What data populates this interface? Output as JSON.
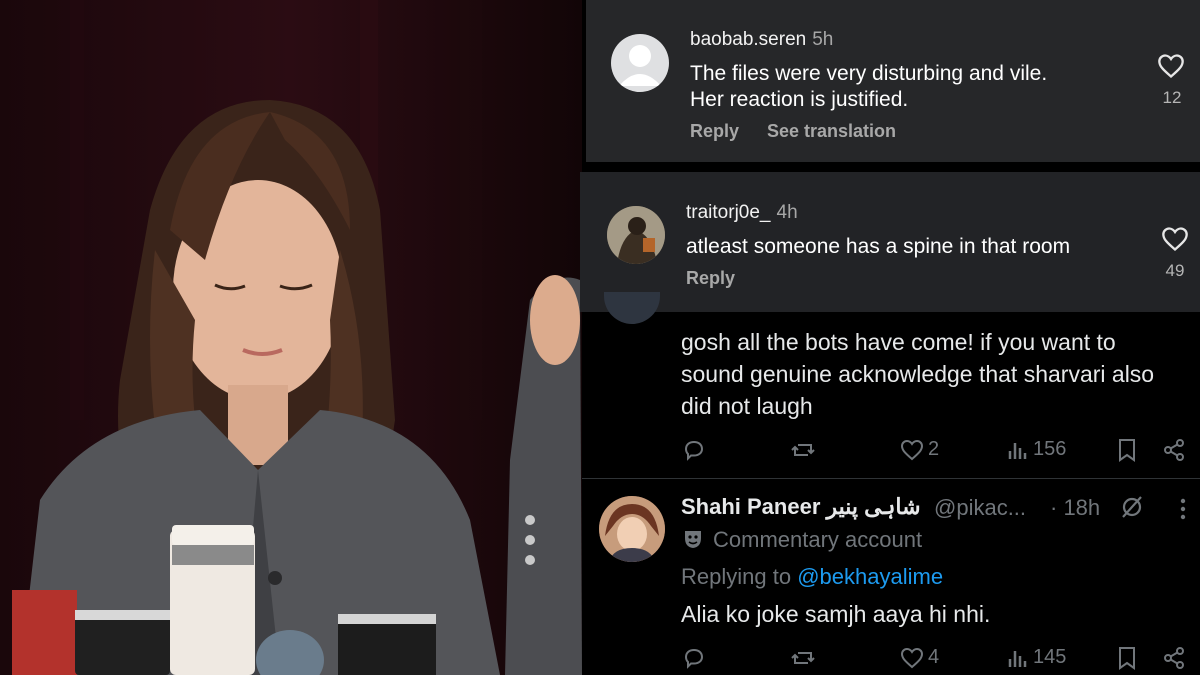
{
  "ig_comments": [
    {
      "username": "baobab.seren",
      "time": "5h",
      "text_line1": "The files were very disturbing and vile.",
      "text_line2": "Her reaction is justified.",
      "likes": "12",
      "reply_label": "Reply",
      "translate_label": "See translation"
    },
    {
      "username": "traitorj0e_",
      "time": "4h",
      "text_line1": "atleast someone has a spine in that room",
      "likes": "49",
      "reply_label": "Reply"
    }
  ],
  "tweets": [
    {
      "text_line1": "gosh all the bots have come! if you want to",
      "text_line2": "sound genuine acknowledge that sharvari also",
      "text_line3": "did not laugh",
      "likes": "2",
      "views": "156"
    },
    {
      "display_name": "Shahi Paneer شاہی پنیر",
      "handle": "@pikac...",
      "time": "· 18h",
      "badge_text": "Commentary account",
      "replying_prefix": "Replying to",
      "replying_to": "@bekhayalime",
      "text": "Alia ko joke samjh aaya hi nhi.",
      "likes": "4",
      "views": "145"
    }
  ],
  "colors": {
    "ig_bg": "#262729",
    "tw_bg": "#000000",
    "link": "#1d9bf0",
    "muted": "#71767b"
  }
}
